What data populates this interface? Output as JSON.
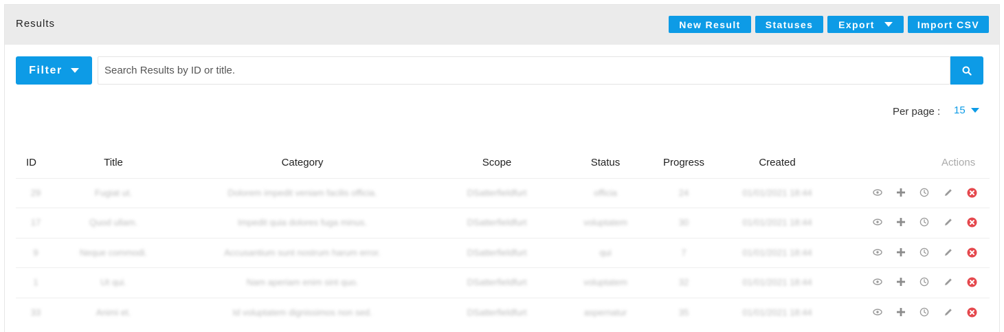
{
  "header": {
    "title": "Results",
    "buttons": {
      "new_result": "New Result",
      "statuses": "Statuses",
      "export": "Export",
      "import_csv": "Import CSV"
    }
  },
  "toolbar": {
    "filter_label": "Filter",
    "search_placeholder": "Search Results by ID or title.",
    "search_icon": "search-icon"
  },
  "pagination": {
    "per_page_label": "Per page :",
    "per_page_value": "15"
  },
  "table": {
    "columns": {
      "id": "ID",
      "title": "Title",
      "category": "Category",
      "scope": "Scope",
      "status": "Status",
      "progress": "Progress",
      "created": "Created",
      "actions": "Actions"
    },
    "rows": [
      {
        "id": "29",
        "title": "Fugiat ut.",
        "category": "Dolorem impedit veniam facilis officia.",
        "scope": "DSatterfieldfurt",
        "status": "officia",
        "progress": "24",
        "created": "01/01/2021 18:44"
      },
      {
        "id": "17",
        "title": "Quod ullam.",
        "category": "Impedit quia dolores fuga minus.",
        "scope": "DSatterfieldfurt",
        "status": "voluptatem",
        "progress": "30",
        "created": "01/01/2021 18:44"
      },
      {
        "id": "9",
        "title": "Neque commodi.",
        "category": "Accusantium sunt nostrum harum error.",
        "scope": "DSatterfieldfurt",
        "status": "qui",
        "progress": "7",
        "created": "01/01/2021 18:44"
      },
      {
        "id": "1",
        "title": "Ut qui.",
        "category": "Nam aperiam enim sint quo.",
        "scope": "DSatterfieldfurt",
        "status": "voluptatem",
        "progress": "32",
        "created": "01/01/2021 18:44"
      },
      {
        "id": "33",
        "title": "Animi et.",
        "category": "Id voluptatem dignissimos non sed.",
        "scope": "DSatterfieldfurt",
        "status": "aspernatur",
        "progress": "35",
        "created": "01/01/2021 18:44"
      }
    ],
    "row_actions": [
      "eye-icon",
      "plus-icon",
      "clock-icon",
      "pencil-icon",
      "delete-icon"
    ]
  },
  "colors": {
    "accent": "#0d9be6",
    "header_bg": "#ebebeb",
    "delete": "#e5484d",
    "icon": "#9a9a9a"
  }
}
